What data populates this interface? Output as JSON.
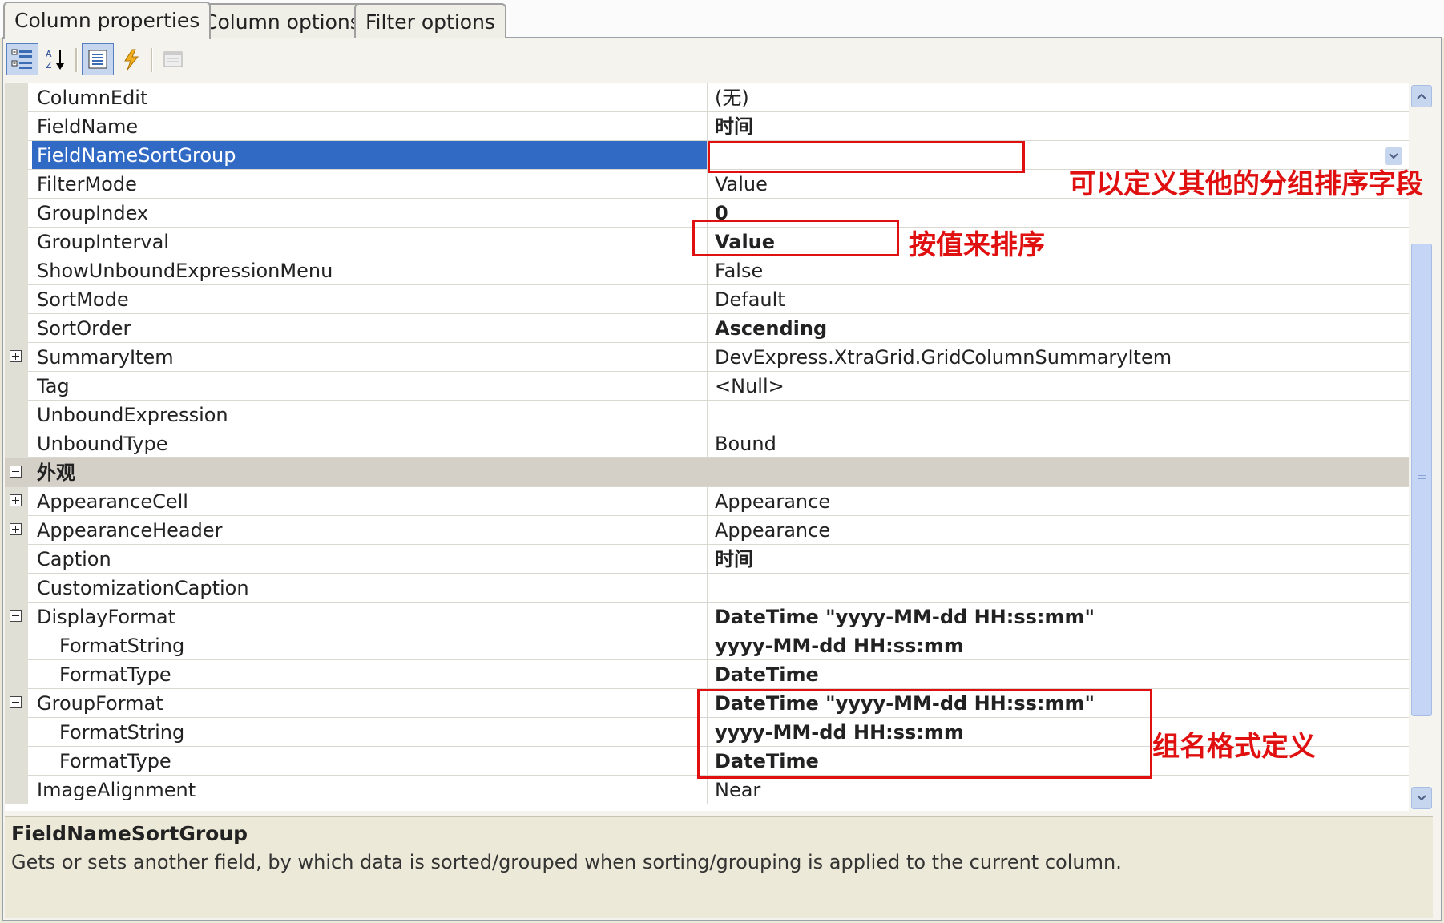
{
  "tabs": [
    {
      "label": "Column properties"
    },
    {
      "label": "Column options"
    },
    {
      "label": "Filter options"
    }
  ],
  "properties": [
    {
      "name": "ColumnEdit",
      "value": "(无)",
      "bold": false
    },
    {
      "name": "FieldName",
      "value": "时间",
      "bold": true
    },
    {
      "name": "FieldNameSortGroup",
      "value": "",
      "bold": false,
      "selected": true
    },
    {
      "name": "FilterMode",
      "value": "Value",
      "bold": false
    },
    {
      "name": "GroupIndex",
      "value": "0",
      "bold": true
    },
    {
      "name": "GroupInterval",
      "value": "Value",
      "bold": true
    },
    {
      "name": "ShowUnboundExpressionMenu",
      "value": "False",
      "bold": false
    },
    {
      "name": "SortMode",
      "value": "Default",
      "bold": false
    },
    {
      "name": "SortOrder",
      "value": "Ascending",
      "bold": true
    },
    {
      "name": "SummaryItem",
      "value": "DevExpress.XtraGrid.GridColumnSummaryItem",
      "bold": false,
      "expander": "plus"
    },
    {
      "name": "Tag",
      "value": "<Null>",
      "bold": false
    },
    {
      "name": "UnboundExpression",
      "value": "",
      "bold": false
    },
    {
      "name": "UnboundType",
      "value": "Bound",
      "bold": false
    },
    {
      "name": "外观",
      "value": "",
      "category": true,
      "expander": "minus"
    },
    {
      "name": "AppearanceCell",
      "value": "Appearance",
      "bold": false,
      "expander": "plus"
    },
    {
      "name": "AppearanceHeader",
      "value": "Appearance",
      "bold": false,
      "expander": "plus"
    },
    {
      "name": "Caption",
      "value": "时间",
      "bold": true
    },
    {
      "name": "CustomizationCaption",
      "value": "",
      "bold": false
    },
    {
      "name": "DisplayFormat",
      "value": "DateTime \"yyyy-MM-dd HH:ss:mm\"",
      "bold": true,
      "expander": "minus"
    },
    {
      "name": "FormatString",
      "value": "yyyy-MM-dd HH:ss:mm",
      "bold": true,
      "indent": true
    },
    {
      "name": "FormatType",
      "value": "DateTime",
      "bold": true,
      "indent": true
    },
    {
      "name": "GroupFormat",
      "value": "DateTime \"yyyy-MM-dd HH:ss:mm\"",
      "bold": true,
      "expander": "minus"
    },
    {
      "name": "FormatString",
      "value": "yyyy-MM-dd HH:ss:mm",
      "bold": true,
      "indent": true
    },
    {
      "name": "FormatType",
      "value": "DateTime",
      "bold": true,
      "indent": true
    },
    {
      "name": "ImageAlignment",
      "value": "Near",
      "bold": false
    }
  ],
  "description": {
    "title": "FieldNameSortGroup",
    "text": "Gets or sets another field, by which data is sorted/grouped when sorting/grouping is applied to the current column."
  },
  "annotations": {
    "sort_group": "可以定义其他的分组排序字段",
    "sort_by_value": "按值来排序",
    "group_name_format": "组名格式定义"
  },
  "colors": {
    "selection": "#316ac5",
    "annotation": "#e01010"
  }
}
